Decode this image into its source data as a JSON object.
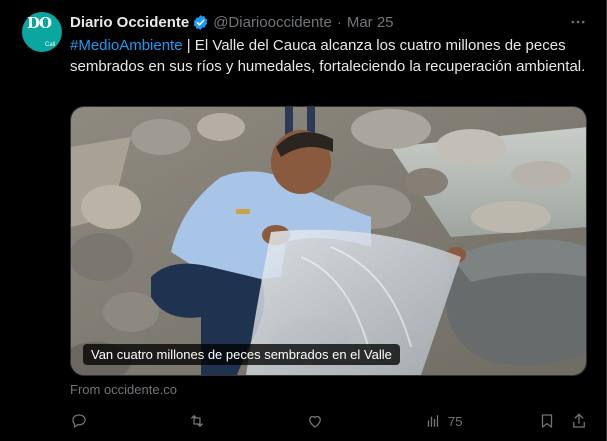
{
  "author": {
    "name": "Diario Occidente",
    "handle": "@Diariooccidente",
    "separator": "·",
    "date": "Mar 25",
    "avatar_monogram_top": "DO",
    "avatar_city": "Cali"
  },
  "tweet": {
    "hashtag": "#MedioAmbiente",
    "body": " | El Valle del Cauca alcanza los cuatro millones de peces sembrados en sus ríos y humedales, fortaleciendo la recuperación ambiental."
  },
  "media": {
    "caption": "Van cuatro millones de peces sembrados en el Valle"
  },
  "source": "From occidente.co",
  "actions": {
    "views_count": "75"
  },
  "colors": {
    "background": "#000000",
    "text": "#e7e9ea",
    "muted": "#71767b",
    "accent": "#1d9bf0",
    "avatar_bg": "#0aa6a0"
  },
  "icons": [
    "verified-badge-icon",
    "more-icon",
    "reply-icon",
    "retweet-icon",
    "like-icon",
    "views-icon",
    "bookmark-icon",
    "share-icon"
  ]
}
